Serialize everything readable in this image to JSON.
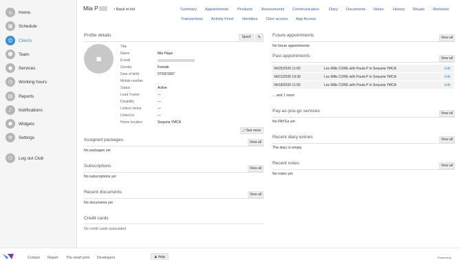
{
  "sidebar": {
    "items": [
      {
        "label": "Home",
        "icon": "home-icon",
        "glyph": "⌂"
      },
      {
        "label": "Schedule",
        "icon": "calendar-icon",
        "glyph": "▦"
      },
      {
        "label": "Clients",
        "icon": "clients-icon",
        "glyph": "☺"
      },
      {
        "label": "Team",
        "icon": "team-icon",
        "glyph": "☻"
      },
      {
        "label": "Services",
        "icon": "services-icon",
        "glyph": "●"
      },
      {
        "label": "Working hours",
        "icon": "clock-icon",
        "glyph": "◷"
      },
      {
        "label": "Reports",
        "icon": "reports-icon",
        "glyph": "▤"
      },
      {
        "label": "Notifications",
        "icon": "bell-icon",
        "glyph": "♪"
      },
      {
        "label": "Widgets",
        "icon": "widgets-icon",
        "glyph": "☗"
      },
      {
        "label": "Settings",
        "icon": "gear-icon",
        "glyph": "✲"
      }
    ],
    "logout": {
      "label": "Log out Club",
      "icon": "logout-icon",
      "glyph": "⏻"
    }
  },
  "header": {
    "client_name": "Mia P",
    "back_label": "Back to list",
    "tabs_row1": [
      "Summary",
      "Appointments",
      "Products",
      "Assessments",
      "Communication",
      "Diary",
      "Documents",
      "Notes",
      "History",
      "Rituals",
      "Workouts"
    ],
    "tabs_row2": [
      "Transactions",
      "Activity Feed",
      "Identities",
      "Door access",
      "App Access"
    ]
  },
  "profile": {
    "title": "Profile details",
    "spoof_label": "Spoof",
    "fields": [
      {
        "label": "Title",
        "value": ""
      },
      {
        "label": "Name",
        "value": "Mia Pique"
      },
      {
        "label": "E-mail",
        "value": ""
      },
      {
        "label": "Gender",
        "value": "Female"
      },
      {
        "label": "Date of birth",
        "value": "07/02/1997"
      },
      {
        "label": "Mobile number",
        "value": ""
      },
      {
        "label": "Status",
        "value": "Active"
      },
      {
        "label": "Lead Trainer",
        "value": "—"
      },
      {
        "label": "Disability",
        "value": "—"
      },
      {
        "label": "Linked clients",
        "value": "—"
      },
      {
        "label": "Linked to",
        "value": "—"
      },
      {
        "label": "Home location",
        "value": "Sequoia YMCA"
      }
    ],
    "see_more_label": "See more"
  },
  "assigned_packages": {
    "title": "Assigned packages",
    "view_all": "View all",
    "empty": "No packages yet"
  },
  "subscriptions": {
    "title": "Subscriptions",
    "view_all": "View all",
    "empty": "No subscriptions yet"
  },
  "recent_documents": {
    "title": "Recent documents",
    "view_all": "View all",
    "empty": "No documents yet"
  },
  "credit_cards": {
    "title": "Credit cards",
    "empty": "No credit cards associated"
  },
  "future_appointments": {
    "title": "Future appointments",
    "view_all": "View all",
    "empty": "No future appointments"
  },
  "past_appointments": {
    "title": "Past appointments",
    "view_all": "View all",
    "rows": [
      {
        "date": "04/25/2026 11:00",
        "desc": "Les Mills CORE with Paula P in Sequoia YMCA",
        "action": "Edit"
      },
      {
        "date": "04/21/2026 19:30",
        "desc": "Les Mills CORE with Paula P in Sequoia YMCA",
        "action": "Edit"
      },
      {
        "date": "04/18/2026 11:00",
        "desc": "Les Mills CORE with Paula P in Sequoia YMCA",
        "action": "Edit"
      }
    ],
    "more": "... and 1 more"
  },
  "payg": {
    "title": "Pay-as-you-go services",
    "view_all": "View all",
    "empty": "No PAYGs yet"
  },
  "diary": {
    "title": "Recent diary entries",
    "view_all": "View all",
    "empty": "The diary is empty"
  },
  "notes": {
    "title": "Recent notes",
    "view_all": "View all",
    "empty": "No notes yet"
  },
  "footer": {
    "links": [
      "Contact",
      "Report",
      "The small print",
      "Developers"
    ],
    "help_label": "Help",
    "powered_by": "Powered by"
  },
  "colors": {
    "accent": "#3a8fd4",
    "link": "#3a5fa8"
  }
}
